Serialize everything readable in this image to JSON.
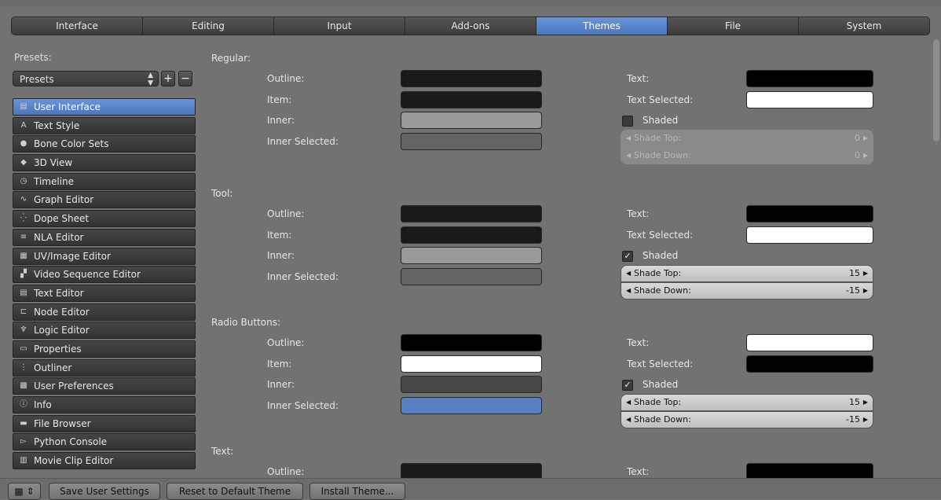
{
  "tabs": [
    "Interface",
    "Editing",
    "Input",
    "Add-ons",
    "Themes",
    "File",
    "System"
  ],
  "active_tab": "Themes",
  "presets": {
    "label": "Presets:",
    "select_value": "Presets",
    "add_symbol": "+",
    "remove_symbol": "−"
  },
  "sidebar": [
    {
      "label": "User Interface",
      "icon": "user-interface-icon",
      "glyph": "▤"
    },
    {
      "label": "Text Style",
      "icon": "text-style-icon",
      "glyph": "A"
    },
    {
      "label": "Bone Color Sets",
      "icon": "bone-color-icon",
      "glyph": "●"
    },
    {
      "label": "3D View",
      "icon": "3d-view-icon",
      "glyph": "◆"
    },
    {
      "label": "Timeline",
      "icon": "timeline-icon",
      "glyph": "◷"
    },
    {
      "label": "Graph Editor",
      "icon": "graph-editor-icon",
      "glyph": "∿"
    },
    {
      "label": "Dope Sheet",
      "icon": "dope-sheet-icon",
      "glyph": "⁛"
    },
    {
      "label": "NLA Editor",
      "icon": "nla-editor-icon",
      "glyph": "≡"
    },
    {
      "label": "UV/Image Editor",
      "icon": "uv-image-icon",
      "glyph": "▦"
    },
    {
      "label": "Video Sequence Editor",
      "icon": "video-sequence-icon",
      "glyph": "▞"
    },
    {
      "label": "Text Editor",
      "icon": "text-editor-icon",
      "glyph": "▤"
    },
    {
      "label": "Node Editor",
      "icon": "node-editor-icon",
      "glyph": "⊏"
    },
    {
      "label": "Logic Editor",
      "icon": "logic-editor-icon",
      "glyph": "♆"
    },
    {
      "label": "Properties",
      "icon": "properties-icon",
      "glyph": "▭"
    },
    {
      "label": "Outliner",
      "icon": "outliner-icon",
      "glyph": "⋮"
    },
    {
      "label": "User Preferences",
      "icon": "user-preferences-icon",
      "glyph": "▩"
    },
    {
      "label": "Info",
      "icon": "info-icon",
      "glyph": "ⓘ"
    },
    {
      "label": "File Browser",
      "icon": "file-browser-icon",
      "glyph": "▬"
    },
    {
      "label": "Python Console",
      "icon": "python-console-icon",
      "glyph": "▻"
    },
    {
      "label": "Movie Clip Editor",
      "icon": "movie-clip-icon",
      "glyph": "▥"
    }
  ],
  "sections": [
    {
      "title": "Regular:",
      "fields": [
        {
          "label": "Outline:",
          "color": "#191919"
        },
        {
          "label": "Item:",
          "color": "#191919"
        },
        {
          "label": "Inner:",
          "color": "#999999"
        },
        {
          "label": "Inner Selected:",
          "color": "#646464"
        }
      ],
      "text": {
        "label": "Text:",
        "color": "#000000"
      },
      "text_selected": {
        "label": "Text Selected:",
        "color": "#ffffff"
      },
      "shaded": {
        "label": "Shaded",
        "checked": false
      },
      "shade_top": {
        "label": "Shade Top:",
        "value": "0"
      },
      "shade_down": {
        "label": "Shade Down:",
        "value": "0"
      }
    },
    {
      "title": "Tool:",
      "fields": [
        {
          "label": "Outline:",
          "color": "#191919"
        },
        {
          "label": "Item:",
          "color": "#191919"
        },
        {
          "label": "Inner:",
          "color": "#999999"
        },
        {
          "label": "Inner Selected:",
          "color": "#646464"
        }
      ],
      "text": {
        "label": "Text:",
        "color": "#000000"
      },
      "text_selected": {
        "label": "Text Selected:",
        "color": "#ffffff"
      },
      "shaded": {
        "label": "Shaded",
        "checked": true
      },
      "shade_top": {
        "label": "Shade Top:",
        "value": "15"
      },
      "shade_down": {
        "label": "Shade Down:",
        "value": "-15"
      }
    },
    {
      "title": "Radio Buttons:",
      "fields": [
        {
          "label": "Outline:",
          "color": "#000000"
        },
        {
          "label": "Item:",
          "color": "#ffffff"
        },
        {
          "label": "Inner:",
          "color": "#464646"
        },
        {
          "label": "Inner Selected:",
          "color": "#5680c2"
        }
      ],
      "text": {
        "label": "Text:",
        "color": "#ffffff"
      },
      "text_selected": {
        "label": "Text Selected:",
        "color": "#000000"
      },
      "shaded": {
        "label": "Shaded",
        "checked": true
      },
      "shade_top": {
        "label": "Shade Top:",
        "value": "15"
      },
      "shade_down": {
        "label": "Shade Down:",
        "value": "-15"
      }
    },
    {
      "title": "Text:",
      "fields": [
        {
          "label": "Outline:",
          "color": "#191919"
        }
      ],
      "text": {
        "label": "Text:",
        "color": "#000000"
      }
    }
  ],
  "bottom": {
    "save": "Save User Settings",
    "reset": "Reset to Default Theme",
    "install": "Install Theme..."
  }
}
